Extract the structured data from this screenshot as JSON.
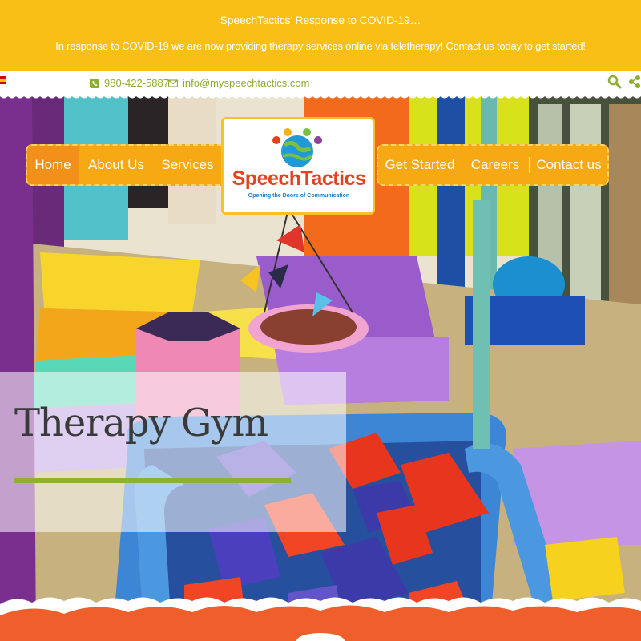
{
  "announcement": {
    "title": "SpeechTactics' Response to COVID-19…",
    "message": "In response to COVID-19 we are now providing therapy services online via teletherapy! Contact us today to get started!"
  },
  "contact": {
    "phone": "980-422-5887",
    "email": "info@myspeechtactics.com",
    "phone_icon": "phone-icon",
    "email_icon": "envelope-icon"
  },
  "nav": {
    "left": [
      "Home",
      "About Us",
      "Services"
    ],
    "right": [
      "Get Started",
      "Careers",
      "Contact us"
    ],
    "active": "Home"
  },
  "logo": {
    "name": "SpeechTactics",
    "tagline": "Opening the Doors of Communication"
  },
  "hero": {
    "title": "Therapy Gym"
  },
  "colors": {
    "announce_bg": "#f9bf14",
    "nav_bg": "#f7a913",
    "accent_green": "#8fb036",
    "brand_red": "#e2431d"
  }
}
